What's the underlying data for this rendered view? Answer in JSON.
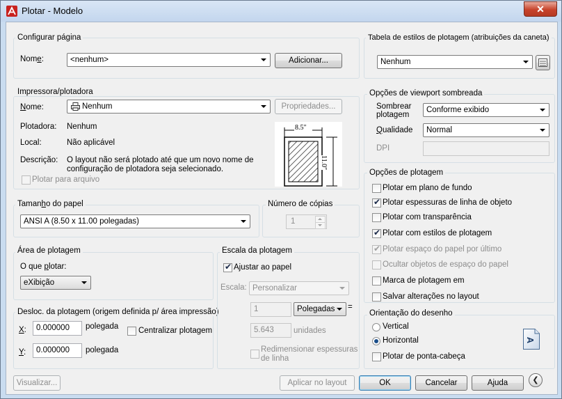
{
  "window": {
    "title": "Plotar - Modelo",
    "close_glyph": "✕"
  },
  "configurar_pagina": {
    "label": "Configurar página",
    "nome_label": "Nome:",
    "nome_value": "<nenhum>",
    "adicionar": "Adicionar..."
  },
  "tabela_estilos": {
    "label": "Tabela de estilos de plotagem (atribuições da caneta)",
    "value": "Nenhum"
  },
  "impressora": {
    "label": "Impressora/plotadora",
    "nome_label": "Nome:",
    "nome_value": "Nenhum",
    "propriedades": "Propriedades...",
    "plotadora_label": "Plotadora:",
    "plotadora_value": "Nenhum",
    "local_label": "Local:",
    "local_value": "Não aplicável",
    "descricao_label": "Descrição:",
    "descricao_line1": "O layout não será plotado até que um novo nome de",
    "descricao_line2": "configuração de plotadora seja selecionado.",
    "plotar_arquivo": "Plotar para arquivo",
    "paper_width": "8.5″",
    "paper_height": "11.0″"
  },
  "viewport": {
    "label": "Opções de viewport sombreada",
    "sombrear_label_1": "Sombrear",
    "sombrear_label_2": "plotagem",
    "sombrear_value": "Conforme exibido",
    "qualidade_label": "Qualidade",
    "qualidade_value": "Normal",
    "dpi_label": "DPI"
  },
  "tamanho_papel": {
    "label": "Tamanho do papel",
    "value": "ANSI A (8.50 x 11.00 polegadas)"
  },
  "copias": {
    "label": "Número de cópias",
    "value": "1"
  },
  "opcoes_plotagem": {
    "label": "Opções de plotagem",
    "items": [
      {
        "label": "Plotar em plano de fundo",
        "checked": false,
        "enabled": true
      },
      {
        "label": "Plotar espessuras de linha de objeto",
        "checked": true,
        "enabled": true
      },
      {
        "label": "Plotar com transparência",
        "checked": false,
        "enabled": true
      },
      {
        "label": "Plotar com estilos de plotagem",
        "checked": true,
        "enabled": true
      },
      {
        "label": "Plotar espaço do papel por último",
        "checked": true,
        "enabled": false
      },
      {
        "label": "Ocultar objetos de espaço do papel",
        "checked": false,
        "enabled": false
      },
      {
        "label": "Marca de plotagem em",
        "checked": false,
        "enabled": true
      },
      {
        "label": "Salvar alterações no layout",
        "checked": false,
        "enabled": true
      }
    ]
  },
  "area_plotagem": {
    "label": "Área de plotagem",
    "o_que_plotar_label": "O que plotar:",
    "value": "eXibição"
  },
  "escala": {
    "label": "Escala da plotagem",
    "ajustar_papel": "Ajustar ao papel",
    "escala_label": "Escala:",
    "escala_value": "Personalizar",
    "num_value": "1",
    "unidade_value": "Polegadas",
    "equals": "=",
    "den_value": "5.643",
    "unidades_label": "unidades",
    "redim_line1": "Redimensionar espessuras",
    "redim_line2": "de linha"
  },
  "deslocamento": {
    "label": "Desloc. da plotagem (origem definida p/ área impressão)",
    "x_label": "X:",
    "x_value": "0.000000",
    "x_unit": "polegada",
    "y_label": "Y:",
    "y_value": "0.000000",
    "y_unit": "polegada",
    "centralizar": "Centralizar plotagem"
  },
  "orientacao": {
    "label": "Orientação do desenho",
    "vertical": "Vertical",
    "horizontal": "Horizontal",
    "selected": "horizontal",
    "cabeca": "Plotar de ponta-cabeça",
    "icon_letter": "A"
  },
  "footer": {
    "visualizar": "Visualizar...",
    "aplicar": "Aplicar no layout",
    "ok": "OK",
    "cancelar": "Cancelar",
    "ajuda": "Ajuda",
    "more_glyph": "❮"
  }
}
